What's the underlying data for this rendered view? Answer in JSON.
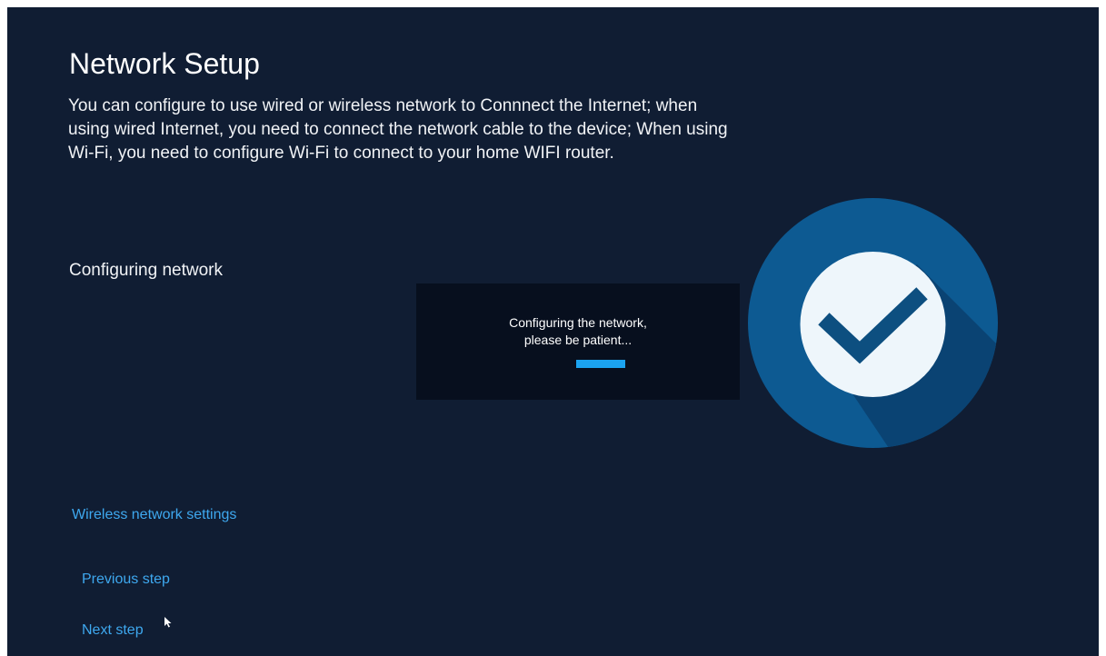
{
  "page": {
    "title": "Network Setup",
    "description": "You can configure to use wired or wireless network to Connnect the Internet; when using wired Internet, you need to connect the network cable to the device; When using Wi-Fi, you need to configure Wi-Fi to connect to your home WIFI router.",
    "section_label": "Configuring network"
  },
  "dialog": {
    "message_line1": "Configuring the network,",
    "message_line2": "please be patient...",
    "progress": 1.0
  },
  "links": {
    "wireless_settings": "Wireless network settings",
    "previous": "Previous step",
    "next": "Next step"
  },
  "icons": {
    "badge": "checkmark-circle-icon",
    "cursor": "mouse-cursor-icon"
  },
  "colors": {
    "background": "#101d33",
    "dialog_background": "#070f1e",
    "accent": "#1ba3f0",
    "link": "#3ea8ef",
    "badge_circle": "#0d5a92",
    "badge_check": "#0d4f80"
  }
}
